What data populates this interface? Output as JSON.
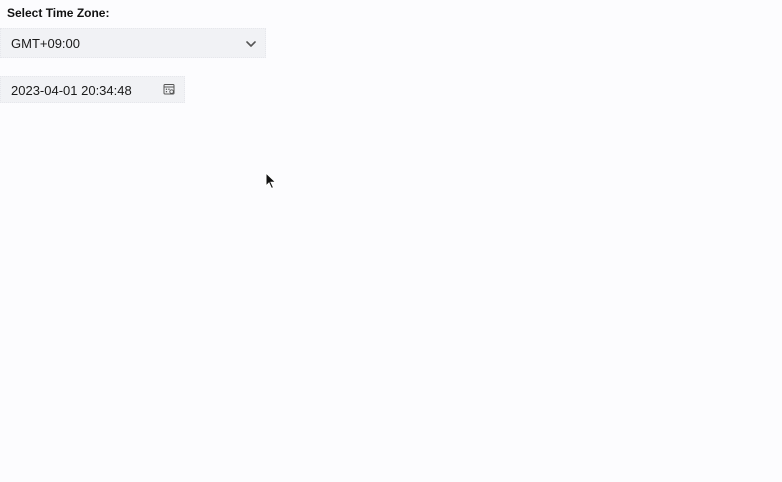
{
  "timezone": {
    "label": "Select Time Zone:",
    "selected": "GMT+09:00"
  },
  "datetime": {
    "value": "2023-04-01 20:34:48"
  },
  "icons": {
    "dropdown": "chevron-down-icon",
    "calendar": "calendar-icon",
    "cursor": "mouse-pointer-icon"
  }
}
